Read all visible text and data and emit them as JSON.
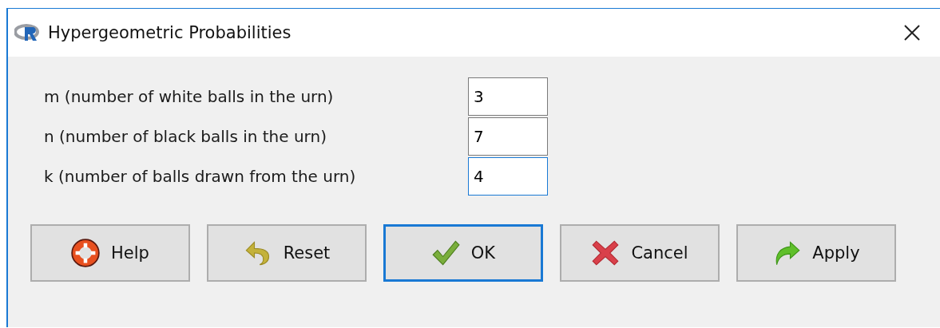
{
  "window": {
    "title": "Hypergeometric Probabilities"
  },
  "fields": [
    {
      "label": "m (number of white balls in the urn)",
      "value": "3",
      "focused": false
    },
    {
      "label": "n (number of black balls in the urn)",
      "value": "7",
      "focused": false
    },
    {
      "label": "k (number of balls drawn from the urn)",
      "value": "4",
      "focused": true
    }
  ],
  "buttons": [
    {
      "label": "Help",
      "kind": "help",
      "default": false
    },
    {
      "label": "Reset",
      "kind": "reset",
      "default": false
    },
    {
      "label": "OK",
      "kind": "ok",
      "default": true
    },
    {
      "label": "Cancel",
      "kind": "cancel",
      "default": false
    },
    {
      "label": "Apply",
      "kind": "apply",
      "default": false
    }
  ]
}
